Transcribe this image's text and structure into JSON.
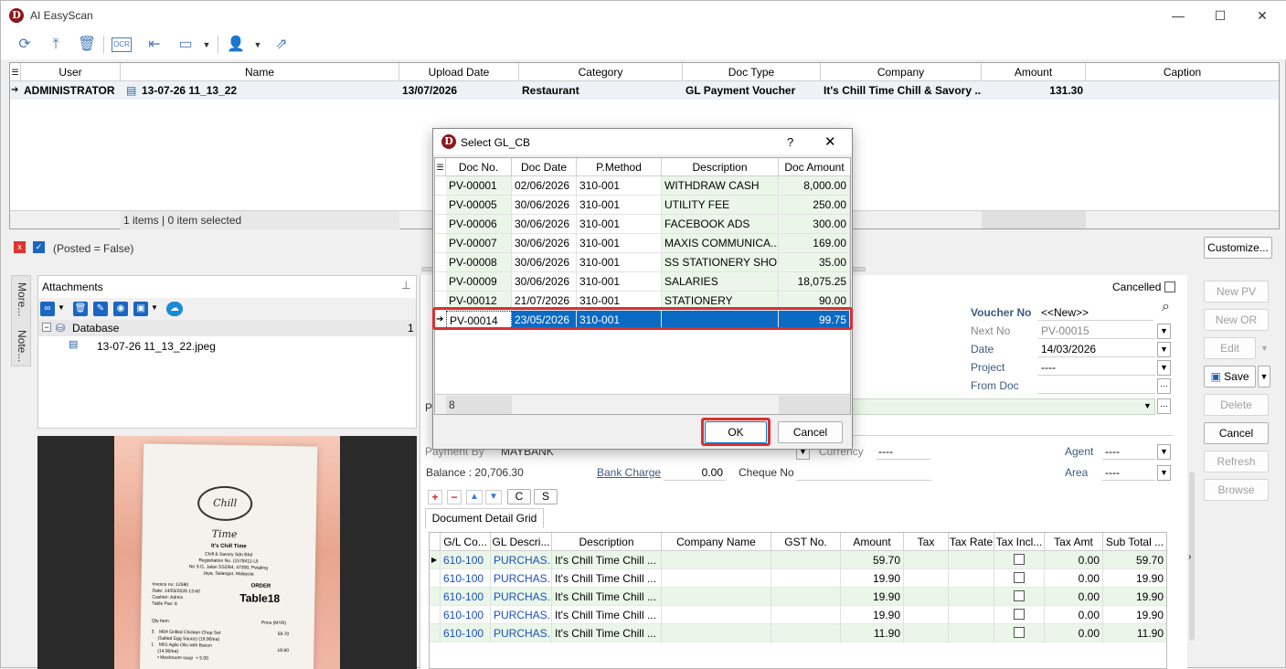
{
  "app": {
    "title": "AI EasyScan",
    "logo_letter": "D",
    "window_controls": {
      "minimize": "—",
      "maximize": "☐",
      "close": "✕"
    }
  },
  "toolbar": {
    "icons": [
      "refresh-icon",
      "upload-icon",
      "delete-icon",
      "ocr-icon",
      "layout-icon",
      "panel-icon",
      "user-icon",
      "share-icon"
    ],
    "ocr_text": "OCR"
  },
  "top_grid": {
    "headers": [
      "User",
      "Name",
      "Upload Date",
      "Category",
      "Doc Type",
      "Company",
      "Amount",
      "Caption"
    ],
    "row": {
      "user": "ADMINISTRATOR",
      "name": "13-07-26 11_13_22",
      "upload_date": "13/07/2026",
      "category": "Restaurant",
      "doc_type": "GL Payment Voucher",
      "company": "It's Chill Time Chill & Savory ...",
      "amount": "131.30",
      "caption": ""
    },
    "footer": "1 items |  0 item selected"
  },
  "filter": {
    "text": "(Posted = False)",
    "customize_label": "Customize..."
  },
  "side_tabs": {
    "more": "More...",
    "note": "Note..."
  },
  "attachments": {
    "title": "Attachments",
    "tree_root": "Database",
    "tree_count": "1",
    "file": "13-07-26 11_13_22.jpeg"
  },
  "receipt": {
    "brand": "Chill Time",
    "shop": "It's Chill Time",
    "company": "Chill & Savory Sdn Bhd",
    "reg": "Registration No. (1578411-U)",
    "address1": "No 3-G, Jalan SS2/64, 47300, Petaling",
    "address2": "Jaya, Selangor, Malaysia",
    "invoice": "Invoice no: 12590",
    "date": "Date: 14/03/2026 13:40",
    "cashier": "Cashier: Admin",
    "pax": "Table Pax: 6",
    "order": "ORDER",
    "table": "Table18",
    "col_qty": "Qty  Item",
    "col_price": "Price (MYR)",
    "line1": "3    M04 Grilled Chicken Chop Set",
    "line1b": "     (Salted Egg Sauce) (19.90/ea)",
    "line1_price": "59.70",
    "line2": "1    M01 Aglio Olio with Bacon",
    "line2b": "     (14.90/ea)",
    "line2_price": "19.90",
    "line3": "     • Mushroom soup  + 5.00"
  },
  "form": {
    "cancelled_label": "Cancelled",
    "voucher_no_label": "Voucher No",
    "voucher_no_value": "<<New>>",
    "next_no_label": "Next No",
    "next_no_value": "PV-00015",
    "date_label": "Date",
    "date_value": "14/03/2026",
    "project_label": "Project",
    "project_value": "----",
    "from_doc_label": "From Doc",
    "from_doc_value": "",
    "payment_by_label": "Payment By",
    "payment_by_value": "MAYBANK",
    "currency_label": "Currency",
    "currency_value": "----",
    "agent_label": "Agent",
    "agent_value": "----",
    "balance_label": "Balance : 20,706.30",
    "bank_charge_label": "Bank Charge",
    "bank_charge_value": "0.00",
    "cheque_no_label": "Cheque No",
    "area_label": "Area",
    "area_value": "----",
    "p_label": "P",
    "c_btn": "C",
    "s_btn": "S"
  },
  "side_buttons": {
    "new_pv": "New PV",
    "new_or": "New OR",
    "edit": "Edit",
    "save": "Save",
    "delete": "Delete",
    "cancel": "Cancel",
    "refresh": "Refresh",
    "browse": "Browse"
  },
  "detail_grid": {
    "tab": "Document Detail Grid",
    "headers": [
      "G/L Co...",
      "GL Descri...",
      "Description",
      "Company Name",
      "GST No.",
      "Amount",
      "Tax",
      "Tax Rate",
      "Tax Incl...",
      "Tax Amt",
      "Sub Total ..."
    ],
    "rows": [
      {
        "gl": "610-100",
        "gldesc": "PURCHAS...",
        "desc": "It's Chill Time Chill ...",
        "amount": "59.70",
        "taxamt": "0.00",
        "subtotal": "59.70"
      },
      {
        "gl": "610-100",
        "gldesc": "PURCHAS...",
        "desc": "It's Chill Time Chill ...",
        "amount": "19.90",
        "taxamt": "0.00",
        "subtotal": "19.90"
      },
      {
        "gl": "610-100",
        "gldesc": "PURCHAS...",
        "desc": "It's Chill Time Chill ...",
        "amount": "19.90",
        "taxamt": "0.00",
        "subtotal": "19.90"
      },
      {
        "gl": "610-100",
        "gldesc": "PURCHAS...",
        "desc": "It's Chill Time Chill ...",
        "amount": "19.90",
        "taxamt": "0.00",
        "subtotal": "19.90"
      },
      {
        "gl": "610-100",
        "gldesc": "PURCHAS...",
        "desc": "It's Chill Time Chill ...",
        "amount": "11.90",
        "taxamt": "0.00",
        "subtotal": "11.90"
      }
    ]
  },
  "dialog": {
    "title": "Select GL_CB",
    "help": "?",
    "close": "✕",
    "headers": [
      "Doc No.",
      "Doc Date",
      "P.Method",
      "Description",
      "Doc Amount"
    ],
    "rows": [
      {
        "doc_no": "PV-00001",
        "doc_date": "02/06/2026",
        "method": "310-001",
        "desc": "WITHDRAW CASH",
        "amount": "8,000.00"
      },
      {
        "doc_no": "PV-00005",
        "doc_date": "30/06/2026",
        "method": "310-001",
        "desc": "UTILITY FEE",
        "amount": "250.00"
      },
      {
        "doc_no": "PV-00006",
        "doc_date": "30/06/2026",
        "method": "310-001",
        "desc": "FACEBOOK ADS",
        "amount": "300.00"
      },
      {
        "doc_no": "PV-00007",
        "doc_date": "30/06/2026",
        "method": "310-001",
        "desc": "MAXIS COMMUNICA...",
        "amount": "169.00"
      },
      {
        "doc_no": "PV-00008",
        "doc_date": "30/06/2026",
        "method": "310-001",
        "desc": "SS STATIONERY SHOP",
        "amount": "35.00"
      },
      {
        "doc_no": "PV-00009",
        "doc_date": "30/06/2026",
        "method": "310-001",
        "desc": "SALARIES",
        "amount": "18,075.25"
      },
      {
        "doc_no": "PV-00012",
        "doc_date": "21/07/2026",
        "method": "310-001",
        "desc": "STATIONERY",
        "amount": "90.00"
      },
      {
        "doc_no": "PV-00014",
        "doc_date": "23/05/2026",
        "method": "310-001",
        "desc": "",
        "amount": "99.75"
      }
    ],
    "count": "8",
    "ok_label": "OK",
    "cancel_label": "Cancel"
  }
}
